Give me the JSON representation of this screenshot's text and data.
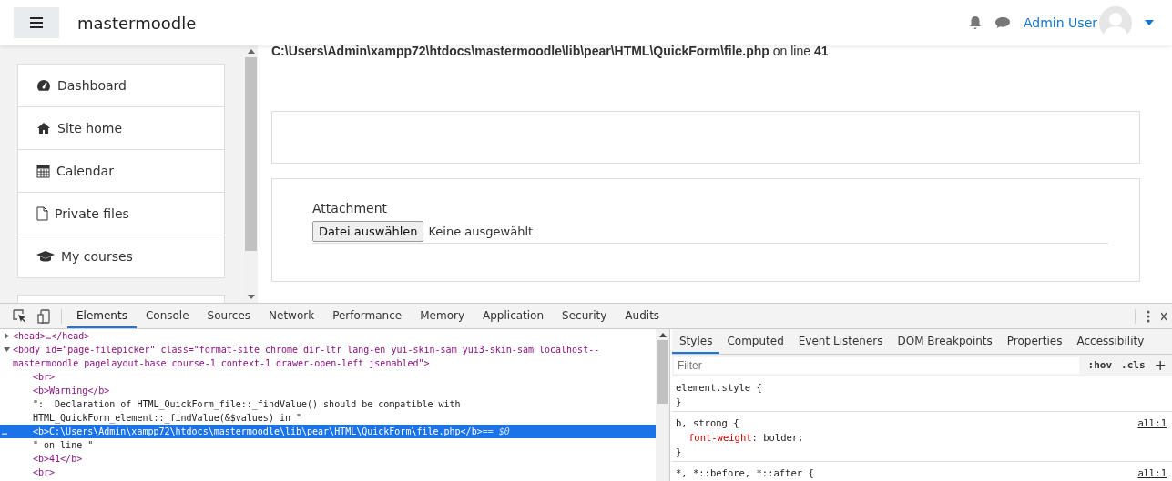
{
  "header": {
    "site_name": "mastermoodle",
    "user_name": "Admin User"
  },
  "sidebar": {
    "items": [
      {
        "label": "Dashboard"
      },
      {
        "label": "Site home"
      },
      {
        "label": "Calendar"
      },
      {
        "label": "Private files"
      },
      {
        "label": "My courses"
      }
    ]
  },
  "main": {
    "error_line": "**C:\\Users\\Admin\\xampp72\\htdocs\\mastermoodle\\lib\\pear\\HTML\\QuickForm\\file.php** on line **41**",
    "attachment_label": "Attachment",
    "file_button": "Datei auswählen",
    "file_status": "Keine ausgewählt"
  },
  "devtools": {
    "tabs": [
      {
        "label": "Elements",
        "selected": true
      },
      {
        "label": "Console",
        "selected": false
      },
      {
        "label": "Sources",
        "selected": false
      },
      {
        "label": "Network",
        "selected": false
      },
      {
        "label": "Performance",
        "selected": false
      },
      {
        "label": "Memory",
        "selected": false
      },
      {
        "label": "Application",
        "selected": false
      },
      {
        "label": "Security",
        "selected": false
      },
      {
        "label": "Audits",
        "selected": false
      }
    ],
    "dom_tree": [
      {
        "text": "<head>…</head>",
        "kind": "tag",
        "expanded": false,
        "selected": false
      },
      {
        "text": "<body id=\"page-filepicker\" class=\"format-site chrome dir-ltr lang-en yui-skin-sam yui3-skin-sam localhost--mastermoodle pagelayout-base course-1 context-1 drawer-open-left jsenabled\">",
        "kind": "tag",
        "expanded": true,
        "selected": false,
        "children": [
          {
            "text": "<br>",
            "kind": "tag",
            "selected": false
          },
          {
            "text": "<b>Warning</b>",
            "kind": "tag",
            "selected": false
          },
          {
            "text": "\":  Declaration of HTML_QuickForm_file::_findValue() should be compatible with HTML_QuickForm_element::_findValue(&$values) in \"",
            "kind": "text",
            "selected": false
          },
          {
            "text": "<b>C:\\Users\\Admin\\xampp72\\htdocs\\mastermoodle\\lib\\pear\\HTML\\QuickForm\\file.php</b>",
            "kind": "tag",
            "selected": true,
            "gutter_mark": "…",
            "marker": "== $0"
          },
          {
            "text": "\" on line \"",
            "kind": "text",
            "selected": false
          },
          {
            "text": "<b>41</b>",
            "kind": "tag",
            "selected": false
          },
          {
            "text": "<br>",
            "kind": "tag",
            "selected": false
          }
        ]
      }
    ],
    "styles_tabs": [
      {
        "label": "Styles",
        "selected": true
      },
      {
        "label": "Computed",
        "selected": false
      },
      {
        "label": "Event Listeners",
        "selected": false
      },
      {
        "label": "DOM Breakpoints",
        "selected": false
      },
      {
        "label": "Properties",
        "selected": false
      },
      {
        "label": "Accessibility",
        "selected": false
      }
    ],
    "filter": {
      "placeholder": "Filter"
    },
    "hov": ":hov",
    "cls": ".cls",
    "add": "+",
    "rules": [
      {
        "selector": "element.style {",
        "close": "}"
      },
      {
        "selector": "b, strong {",
        "source": "all:1",
        "declarations": [
          {
            "property": "font-weight",
            "separator": ":",
            "value": "bolder;"
          }
        ],
        "close": "}"
      },
      {
        "selector": "*, *::before, *::after {",
        "source": "all:1"
      }
    ]
  }
}
